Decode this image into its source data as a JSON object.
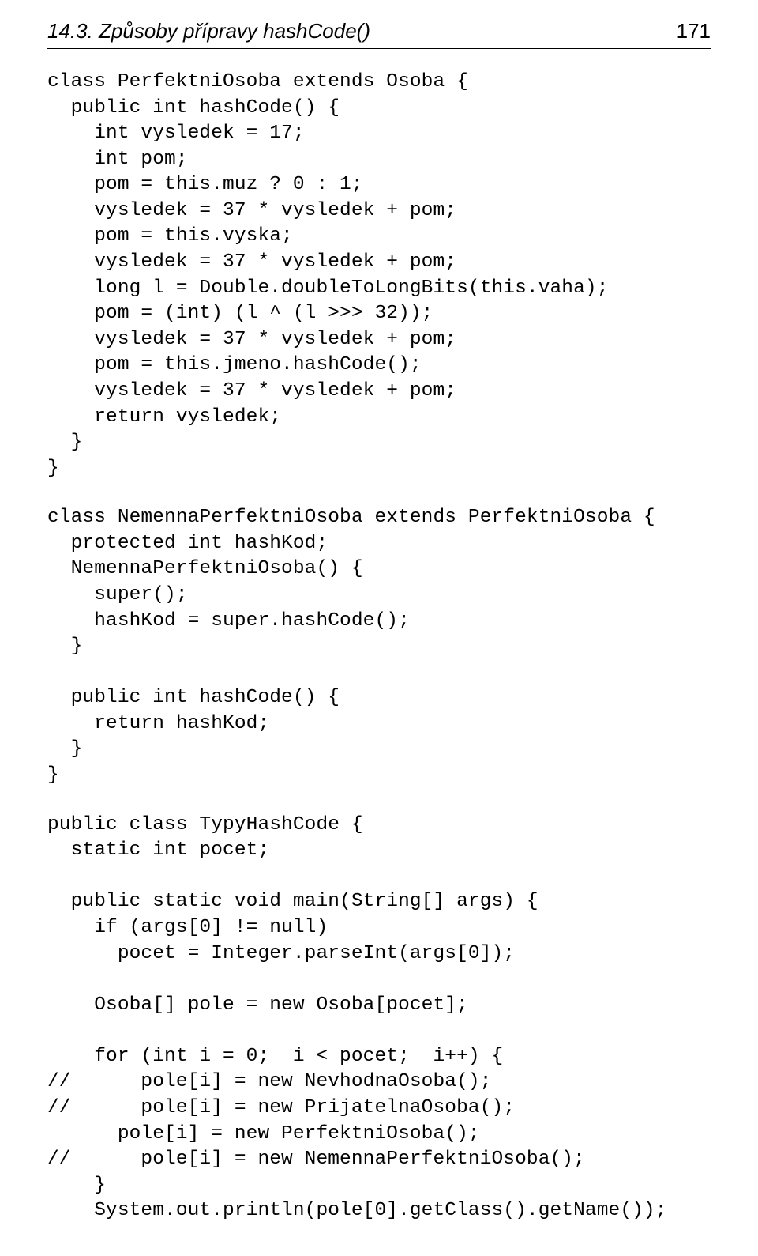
{
  "header": {
    "title": "14.3. Způsoby přípravy hashCode()",
    "page_number": "171"
  },
  "code_blocks": [
    "class PerfektniOsoba extends Osoba {\n  public int hashCode() {\n    int vysledek = 17;\n    int pom;\n    pom = this.muz ? 0 : 1;\n    vysledek = 37 * vysledek + pom;\n    pom = this.vyska;\n    vysledek = 37 * vysledek + pom;\n    long l = Double.doubleToLongBits(this.vaha);\n    pom = (int) (l ^ (l >>> 32));\n    vysledek = 37 * vysledek + pom;\n    pom = this.jmeno.hashCode();\n    vysledek = 37 * vysledek + pom;\n    return vysledek;\n  }\n}",
    "class NemennaPerfektniOsoba extends PerfektniOsoba {\n  protected int hashKod;\n  NemennaPerfektniOsoba() {\n    super();\n    hashKod = super.hashCode();\n  }\n\n  public int hashCode() {\n    return hashKod;\n  }\n}",
    "public class TypyHashCode {\n  static int pocet;\n\n  public static void main(String[] args) {\n    if (args[0] != null)\n      pocet = Integer.parseInt(args[0]);\n\n    Osoba[] pole = new Osoba[pocet];\n\n    for (int i = 0;  i < pocet;  i++) {\n//      pole[i] = new NevhodnaOsoba();\n//      pole[i] = new PrijatelnaOsoba();\n      pole[i] = new PerfektniOsoba();\n//      pole[i] = new NemennaPerfektniOsoba();\n    }\n    System.out.println(pole[0].getClass().getName());"
  ]
}
